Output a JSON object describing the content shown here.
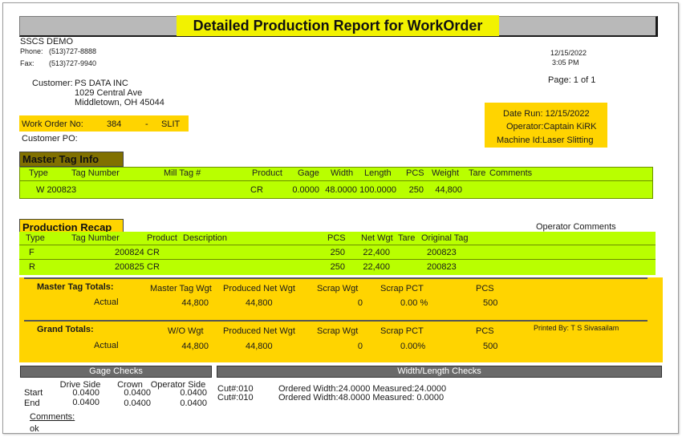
{
  "report": {
    "title": "Detailed Production Report for WorkOrder",
    "company": "SSCS DEMO",
    "phone_label": "Phone:",
    "phone": "(513)727-8888",
    "fax_label": "Fax:",
    "fax": "(513)727-9940",
    "date": "12/15/2022",
    "time": "3:05 PM",
    "page": "Page: 1 of 1"
  },
  "customer": {
    "label": "Customer:",
    "name": "PS DATA INC",
    "address1": "1029 Central Ave",
    "address2": "Middletown, OH 45044",
    "po_label": "Customer PO:"
  },
  "work_order": {
    "label": "Work Order No:",
    "number": "384",
    "sep": "-",
    "type": "SLIT"
  },
  "run_info": {
    "date_run": "Date Run:  12/15/2022",
    "operator": "Operator:Captain KiRK",
    "machine": "Machine Id:Laser Slitting"
  },
  "master_tag": {
    "title": "Master Tag Info",
    "headers": [
      "Type",
      "Tag Number",
      "Mill Tag #",
      "Product",
      "Gage",
      "Width",
      "Length",
      "PCS",
      "Weight",
      "Tare",
      "Comments"
    ],
    "row": {
      "type_tag": "W 200823",
      "product": "CR",
      "gage": "0.0000",
      "width": "48.0000",
      "length": "100.0000",
      "pcs": "250",
      "weight": "44,800"
    }
  },
  "recap": {
    "title": "Production Recap",
    "operator_comments": "Operator Comments",
    "headers": [
      "Type",
      "Tag Number",
      "Product",
      "Description",
      "PCS",
      "Net Wgt",
      "Tare",
      "Original Tag"
    ],
    "rows": [
      {
        "type": "F",
        "tag": "200824",
        "product": "CR",
        "pcs": "250",
        "net": "22,400",
        "orig": "200823"
      },
      {
        "type": "R",
        "tag": "200825",
        "product": "CR",
        "pcs": "250",
        "net": "22,400",
        "orig": "200823"
      }
    ]
  },
  "master_totals": {
    "label": "Master Tag Totals:",
    "col1": "Master Tag Wgt",
    "col2": "Produced Net Wgt",
    "col3": "Scrap Wgt",
    "col4": "Scrap PCT",
    "col5": "PCS",
    "row_label": "Actual",
    "v1": "44,800",
    "v2": "44,800",
    "v3": "0",
    "v4": "0.00 %",
    "v5": "500"
  },
  "grand_totals": {
    "label": "Grand Totals:",
    "col1": "W/O Wgt",
    "col2": "Produced Net Wgt",
    "col3": "Scrap Wgt",
    "col4": "Scrap PCT",
    "col5": "PCS",
    "printed_by": "Printed By:  T S Sivasailam",
    "row_label": "Actual",
    "v1": "44,800",
    "v2": "44,800",
    "v3": "0",
    "v4": "0.00%",
    "v5": "500"
  },
  "gage_checks": {
    "title": "Gage Checks",
    "drive_side": "Drive Side",
    "crown": "Crown",
    "operator_side": "Operator Side",
    "start_label": "Start",
    "end_label": "End",
    "start": [
      "0.0400",
      "0.0400",
      "0.0400"
    ],
    "end": [
      "0.0400",
      "0.0400",
      "0.0400"
    ],
    "comments_label": "Comments:",
    "comments": "ok"
  },
  "width_length": {
    "title": "Width/Length Checks",
    "rows": [
      {
        "cut": "Cut#:010",
        "text": "Ordered Width:24.0000 Measured:24.0000"
      },
      {
        "cut": "Cut#:010",
        "text": "Ordered Width:48.0000 Measured: 0.0000"
      }
    ]
  },
  "colors": {
    "highlight_yellow": "#ffd400",
    "title_yellow": "#f2f200",
    "lime": "#b9ff00",
    "grey_bar": "#6a6a6a"
  }
}
